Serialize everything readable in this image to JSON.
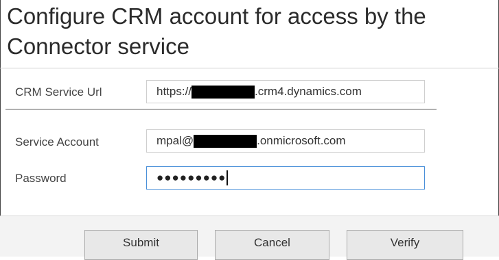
{
  "dialog": {
    "title": "Configure CRM account for access by the Connector service"
  },
  "crm": {
    "url_label": "CRM Service Url",
    "url_prefix": "https://",
    "url_suffix": ".crm4.dynamics.com"
  },
  "account": {
    "service_label": "Service Account",
    "service_prefix": "mpal@",
    "service_suffix": ".onmicrosoft.com",
    "password_label": "Password",
    "password_mask": "●●●●●●●●●"
  },
  "buttons": {
    "submit": "Submit",
    "cancel": "Cancel",
    "verify": "Verify"
  }
}
